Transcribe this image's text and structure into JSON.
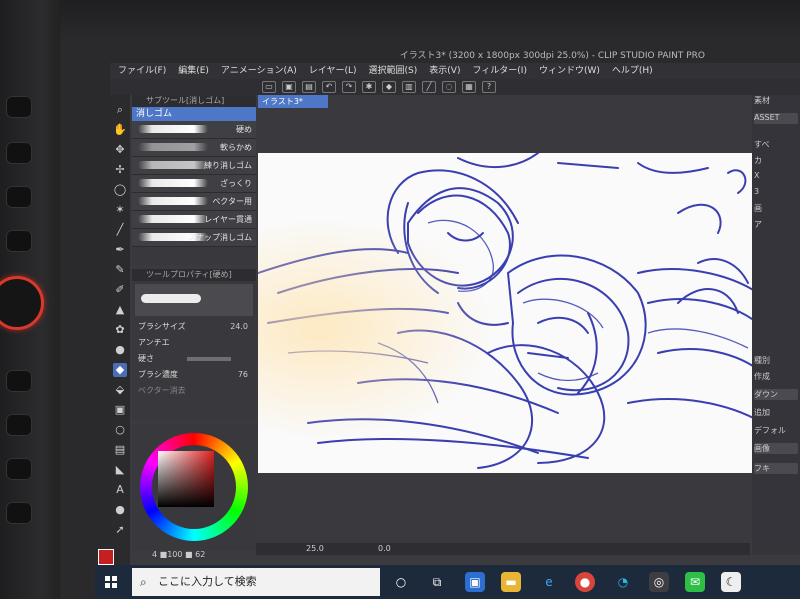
{
  "window": {
    "title": "イラスト3* (3200 x 1800px 300dpi 25.0%) - CLIP STUDIO PAINT PRO"
  },
  "menu": [
    "ファイル(F)",
    "編集(E)",
    "アニメーション(A)",
    "レイヤー(L)",
    "選択範囲(S)",
    "表示(V)",
    "フィルター(I)",
    "ウィンドウ(W)",
    "ヘルプ(H)"
  ],
  "subtool": {
    "tab": "サブツール[消しゴム]",
    "header": "消しゴム",
    "brushes": [
      "硬め",
      "軟らかめ",
      "練り消しゴム",
      "ざっくり",
      "ベクター用",
      "レイヤー貫通",
      "スナップ消しゴム"
    ]
  },
  "toolprop": {
    "tab": "ツールプロパティ[硬め]",
    "brush_size_label": "ブラシサイズ",
    "brush_size": "24.0",
    "antialias_label": "アンチエ",
    "hardness_label": "硬さ",
    "density_label": "ブラシ濃度",
    "density": "76",
    "vector_label": "ベクター消去"
  },
  "color": {
    "foreground": "#c42020",
    "values": "4 ■100 ■ 62"
  },
  "canvas": {
    "tab": "イラスト3*"
  },
  "status": {
    "zoom": "25.0",
    "rotation": "0.0"
  },
  "right": {
    "items": [
      "素材",
      "ASSET",
      "すべ",
      "カ",
      "X",
      "3",
      "画",
      "ア",
      "種別",
      "作成",
      "ダウン",
      "追加",
      "デフォル",
      "画像",
      "フキ"
    ]
  },
  "taskbar": {
    "search_placeholder": "ここに入力して検索"
  }
}
